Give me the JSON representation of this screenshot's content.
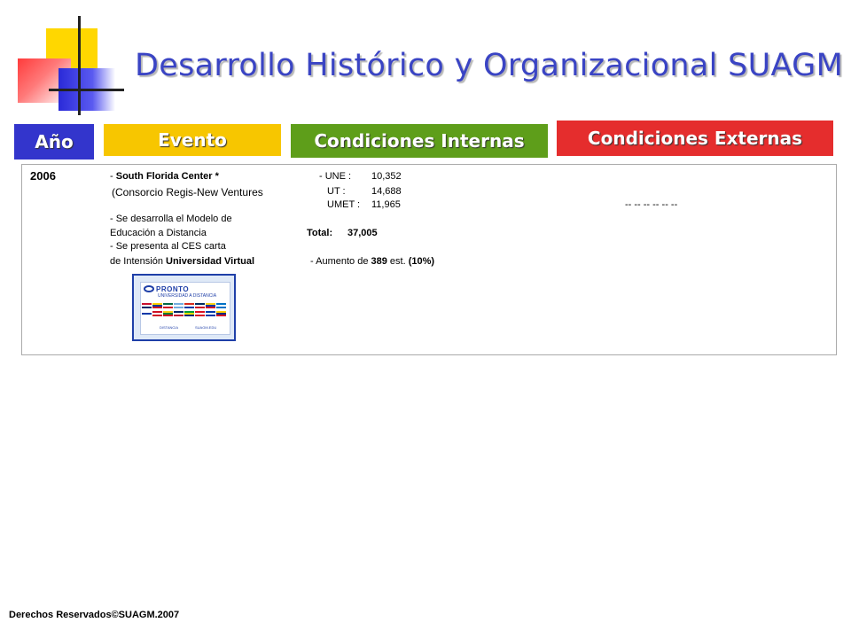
{
  "title": "Desarrollo Histórico y Organizacional SUAGM",
  "headers": {
    "ano": "Año",
    "evento": "Evento",
    "internas": "Condiciones Internas",
    "externas": "Condiciones Externas"
  },
  "row": {
    "year": "2006",
    "evento": {
      "line1_prefix": "- ",
      "line1_bold": "South Florida Center *",
      "line2": "(Consorcio Regis-New Ventures",
      "line3": "- Se desarrolla el Modelo de",
      "line4": " Educación a Distancia",
      "line5": "- Se presenta al  CES carta",
      "line6_prefix": "de Intensión ",
      "line6_bold": "Universidad Virtual"
    },
    "internas": {
      "une_label": "- UNE :",
      "une_value": "10,352",
      "ut_label": "UT   :",
      "ut_value": "14,688",
      "umet_label": "UMET :",
      "umet_value": "11,965",
      "total_label": "Total:",
      "total_value": "37,005",
      "aumento_prefix": "- Aumento de ",
      "aumento_bold": "389",
      "aumento_mid": " est. ",
      "aumento_pct": "(10%)"
    },
    "externas": "-- -- -- -- -- --"
  },
  "logo": {
    "name": "PRONTO",
    "subtitle": "UNIVERSIDAD A DISTANCIA",
    "footer_left": "DISTANCIA",
    "footer_right": "SUAGM.EDU"
  },
  "colors": {
    "title": "#3a44c4",
    "ano": "#3335cc",
    "evento": "#f7c600",
    "internas": "#5e9e1a",
    "externas": "#e52d2d"
  },
  "footer": "Derechos Reservados©SUAGM.2007"
}
